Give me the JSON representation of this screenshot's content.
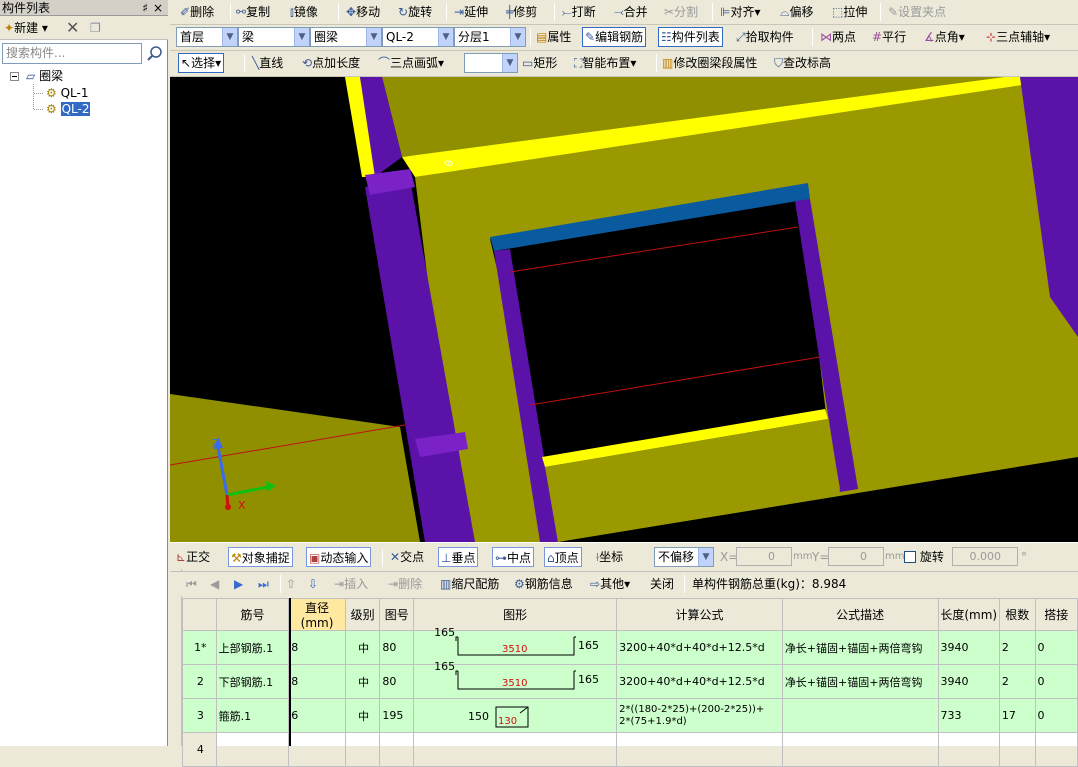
{
  "left_panel": {
    "title": "构件列表",
    "pin": "♯",
    "close": "×",
    "new_label": "新建",
    "search_placeholder": "搜索构件...",
    "tree_root": "圈梁",
    "items": [
      "QL-1",
      "QL-2"
    ],
    "selected_index": 1
  },
  "toolbar1": {
    "delete": "删除",
    "copy": "复制",
    "mirror": "镜像",
    "move": "移动",
    "rotate": "旋转",
    "extend": "延伸",
    "trim": "修剪",
    "break": "打断",
    "merge": "合并",
    "split": "分割",
    "align": "对齐",
    "offset": "偏移",
    "stretch": "拉伸",
    "set_grip": "设置夹点"
  },
  "toolbar2": {
    "floor": "首层",
    "type": "梁",
    "subtype": "圈梁",
    "member": "QL-2",
    "layer": "分层1",
    "props": "属性",
    "edit_rebar": "编辑钢筋",
    "member_list": "构件列表",
    "pick": "拾取构件",
    "two_points": "两点",
    "parallel": "平行",
    "point_angle": "点角",
    "three_point_aux": "三点辅轴"
  },
  "toolbar3": {
    "select": "选择",
    "line": "直线",
    "point_length": "点加长度",
    "arc": "三点画弧",
    "rect": "矩形",
    "smart": "智能布置",
    "modify_seg": "修改圈梁段属性",
    "check_elev": "查改标高"
  },
  "viewport": {
    "label_text": "0",
    "axis_z": "Z",
    "axis_x": "X"
  },
  "snap_bar": {
    "ortho": "正交",
    "object_snap": "对象捕捉",
    "dynamic_input": "动态输入",
    "intersection": "交点",
    "perpendicular": "垂点",
    "midpoint": "中点",
    "vertex": "顶点",
    "coordinate": "坐标",
    "offset_mode": "不偏移",
    "x_label": "X=",
    "x_value": "0",
    "y_label": "Y=",
    "y_value": "0",
    "mm": "mm",
    "rotate": "旋转",
    "rotate_value": "0.000",
    "degree": "°"
  },
  "rebar_toolbar": {
    "insert": "插入",
    "delete": "删除",
    "scale": "缩尺配筋",
    "info": "钢筋信息",
    "other": "其他",
    "close": "关闭",
    "total_weight": "单构件钢筋总重(kg)：8.984"
  },
  "rebar_table": {
    "headers": [
      "筋号",
      "直径(mm)",
      "级别",
      "图号",
      "图形",
      "计算公式",
      "公式描述",
      "长度(mm)",
      "根数",
      "搭接"
    ],
    "rows": [
      {
        "no": "1*",
        "name": "上部钢筋.1",
        "dia": "8",
        "grade": "中",
        "fig": "80",
        "left": "165",
        "mid": "3510",
        "right": "165",
        "formula": "3200+40*d+40*d+12.5*d",
        "desc": "净长+锚固+锚固+两倍弯钩",
        "length": "3940",
        "count": "2",
        "lap": "0"
      },
      {
        "no": "2",
        "name": "下部钢筋.1",
        "dia": "8",
        "grade": "中",
        "fig": "80",
        "left": "165",
        "mid": "3510",
        "right": "165",
        "formula": "3200+40*d+40*d+12.5*d",
        "desc": "净长+锚固+锚固+两倍弯钩",
        "length": "3940",
        "count": "2",
        "lap": "0"
      },
      {
        "no": "3",
        "name": "箍筋.1",
        "dia": "6",
        "grade": "中",
        "fig": "195",
        "left": "150",
        "mid": "130",
        "right": "",
        "formula": "2*((180-2*25)+(200-2*25))+",
        "formula2": "2*(75+1.9*d)",
        "desc": "",
        "length": "733",
        "count": "17",
        "lap": "0"
      },
      {
        "no": "4",
        "name": "",
        "dia": "",
        "grade": "",
        "fig": "",
        "left": "",
        "mid": "",
        "right": "",
        "formula": "",
        "desc": "",
        "length": "",
        "count": "",
        "lap": ""
      }
    ]
  },
  "colors": {
    "beam_yellow": "#9a9a00",
    "column_purple": "#5a12a8",
    "top_blue": "#0a5aa0",
    "bright_yellow": "#ffff00",
    "grid_green": "#ccffcc"
  }
}
